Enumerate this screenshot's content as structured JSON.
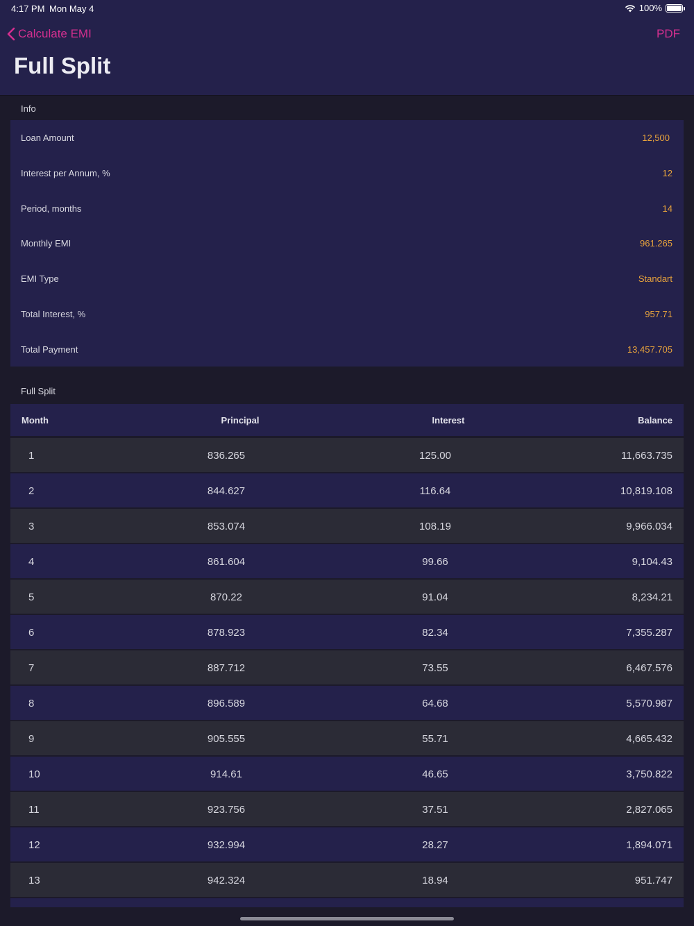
{
  "status_bar": {
    "time": "4:17 PM",
    "date": "Mon May 4",
    "battery": "100%"
  },
  "nav": {
    "back_label": "Calculate EMI",
    "pdf_label": "PDF",
    "title": "Full Split"
  },
  "info": {
    "section_label": "Info",
    "rows": [
      {
        "label": "Loan Amount",
        "value": "12,500"
      },
      {
        "label": "Interest per Annum, %",
        "value": "12"
      },
      {
        "label": "Period, months",
        "value": "14"
      },
      {
        "label": "Monthly EMI",
        "value": "961.265"
      },
      {
        "label": "EMI Type",
        "value": "Standart"
      },
      {
        "label": "Total Interest, %",
        "value": "957.71"
      },
      {
        "label": "Total Payment",
        "value": "13,457.705"
      }
    ]
  },
  "split": {
    "section_label": "Full Split",
    "columns": [
      "Month",
      "Principal",
      "Interest",
      "Balance"
    ],
    "rows": [
      {
        "month": "1",
        "principal": "836.265",
        "interest": "125.00",
        "balance": "11,663.735"
      },
      {
        "month": "2",
        "principal": "844.627",
        "interest": "116.64",
        "balance": "10,819.108"
      },
      {
        "month": "3",
        "principal": "853.074",
        "interest": "108.19",
        "balance": "9,966.034"
      },
      {
        "month": "4",
        "principal": "861.604",
        "interest": "99.66",
        "balance": "9,104.43"
      },
      {
        "month": "5",
        "principal": "870.22",
        "interest": "91.04",
        "balance": "8,234.21"
      },
      {
        "month": "6",
        "principal": "878.923",
        "interest": "82.34",
        "balance": "7,355.287"
      },
      {
        "month": "7",
        "principal": "887.712",
        "interest": "73.55",
        "balance": "6,467.576"
      },
      {
        "month": "8",
        "principal": "896.589",
        "interest": "64.68",
        "balance": "5,570.987"
      },
      {
        "month": "9",
        "principal": "905.555",
        "interest": "55.71",
        "balance": "4,665.432"
      },
      {
        "month": "10",
        "principal": "914.61",
        "interest": "46.65",
        "balance": "3,750.822"
      },
      {
        "month": "11",
        "principal": "923.756",
        "interest": "37.51",
        "balance": "2,827.065"
      },
      {
        "month": "12",
        "principal": "932.994",
        "interest": "28.27",
        "balance": "1,894.071"
      },
      {
        "month": "13",
        "principal": "942.324",
        "interest": "18.94",
        "balance": "951.747"
      }
    ]
  },
  "colors": {
    "accent": "#d32f8f",
    "value": "#e8a33c",
    "surface": "#24214b",
    "background": "#1c1a2a"
  }
}
